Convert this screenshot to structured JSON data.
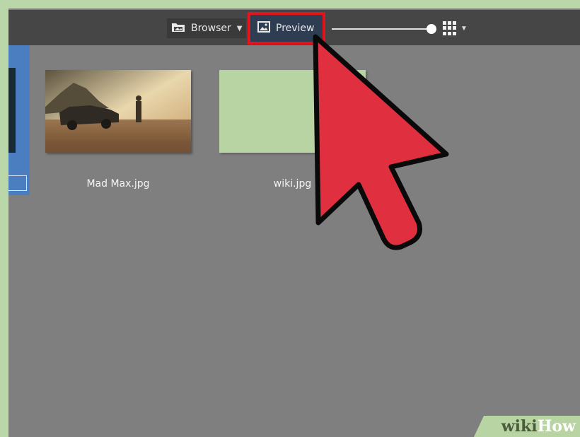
{
  "toolbar": {
    "browser_label": "Browser",
    "preview_label": "Preview",
    "browser_icon": "folder-photo-icon",
    "preview_icon": "image-icon",
    "view_icon": "grid-view-icon",
    "dropdown_icon": "chevron-down-icon",
    "zoom_level": 1.0
  },
  "files": [
    {
      "name": "Mad Max.jpg"
    },
    {
      "name": "wiki.jpg"
    }
  ],
  "colors": {
    "background": "#7f7f7f",
    "toolbar": "#464646",
    "highlight_border": "#e4141d",
    "cursor_fill": "#e02f3e",
    "selection_blue": "#4a7ec0",
    "wiki_thumb": "#b9d4a3"
  },
  "watermark": {
    "part1": "wiki",
    "part2": "How"
  }
}
